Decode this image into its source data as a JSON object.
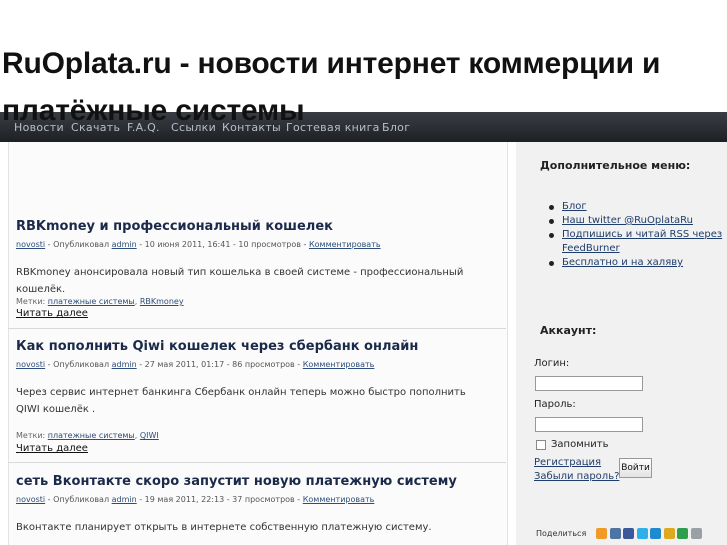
{
  "site": {
    "title": "RuOplata.ru - новости интернет коммерции и платёжные системы"
  },
  "nav": {
    "items": [
      {
        "label": "Новости"
      },
      {
        "label": "Скачать"
      },
      {
        "label": "F.A.Q."
      },
      {
        "label": "Ссылки"
      },
      {
        "label": "Контакты"
      },
      {
        "label": "Гостевая книга"
      },
      {
        "label": "Блог"
      }
    ]
  },
  "posts": [
    {
      "title": "RBKmoney и профессиональный кошелек",
      "category": "novosti",
      "meta_mid": " - Опубликовал ",
      "author": "admin",
      "meta_tail": " - 10 июня 2011, 16:41 - 10 просмотров - ",
      "comment": "Комментировать",
      "excerpt": "RBKmoney анонсировала новый тип кошелька в своей системе - профессиональный кошелёк.",
      "tags_label": "Метки: ",
      "tags": [
        "платежные системы",
        "RBKmoney"
      ],
      "read_more": "Читать далее"
    },
    {
      "title": "Как пополнить Qiwi кошелек через сбербанк онлайн",
      "category": "novosti",
      "meta_mid": " - Опубликовал ",
      "author": "admin",
      "meta_tail": " - 27 мая 2011, 01:17 - 86 просмотров - ",
      "comment": "Комментировать",
      "excerpt": "Через сервис интернет банкинга Сбербанк онлайн теперь можно быстро пополнить QIWI кошелёк .",
      "tags_label": "Метки: ",
      "tags": [
        "платежные системы",
        "QIWI"
      ],
      "read_more": "Читать далее"
    },
    {
      "title": "сеть Вконтакте скоро запустит новую платежную систему",
      "category": "novosti",
      "meta_mid": " - Опубликовал ",
      "author": "admin",
      "meta_tail": " - 19 мая 2011, 22:13 - 37 просмотров - ",
      "comment": "Комментировать",
      "excerpt": "Вконтакте планирует открыть в интернете собственную платежную систему."
    }
  ],
  "sidebar": {
    "menu_title": "Дополнительное меню:",
    "menu_items": [
      {
        "label": "Блог"
      },
      {
        "label": "Наш twitter @RuOplataRu"
      },
      {
        "label": "Подпишись и читай RSS через FeedBurner"
      },
      {
        "label": "Бесплатно и на халяву"
      }
    ],
    "account_title": "Аккаунт:",
    "login_label": "Логин:",
    "password_label": "Пароль:",
    "remember_label": "Запомнить",
    "register_link": "Регистрация",
    "forgot_link": "Забыли пароль?",
    "login_button": "Войти",
    "share_label": "Поделиться",
    "share_icons": [
      {
        "name": "odnoklassniki-icon",
        "color": "#f29a25"
      },
      {
        "name": "vkontakte-icon",
        "color": "#4c75a3"
      },
      {
        "name": "facebook-icon",
        "color": "#3b5998"
      },
      {
        "name": "twitter-icon",
        "color": "#2fb0e8"
      },
      {
        "name": "moimir-icon",
        "color": "#1e8bd0"
      },
      {
        "name": "friendfeed-icon",
        "color": "#e0a81c"
      },
      {
        "name": "livejournal-icon",
        "color": "#2e9e4a"
      },
      {
        "name": "google-icon",
        "color": "#9aa0a6"
      }
    ]
  }
}
